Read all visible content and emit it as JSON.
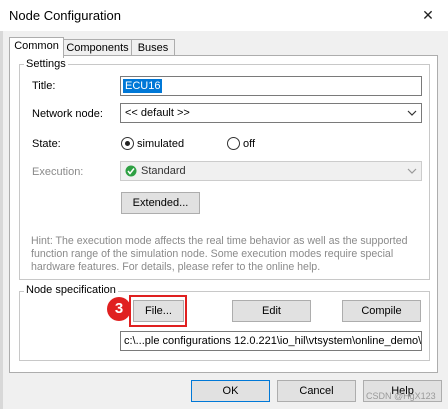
{
  "window": {
    "title": "Node Configuration",
    "close_glyph": "✕"
  },
  "tabs": [
    {
      "label": "Common",
      "active": true
    },
    {
      "label": "Components",
      "active": false
    },
    {
      "label": "Buses",
      "active": false
    }
  ],
  "settings": {
    "legend": "Settings",
    "title_label": "Title:",
    "title_value": "ECU16",
    "network_label": "Network node:",
    "network_value": "<< default >>",
    "state_label": "State:",
    "state_options": [
      "simulated",
      "off"
    ],
    "state_selected": "simulated",
    "execution_label": "Execution:",
    "execution_value": "Standard",
    "extended_button": "Extended...",
    "hint": "Hint: The execution mode affects the real time behavior as well as the supported function range of the simulation node. Some execution modes require special hardware features. For details, please refer to the online help."
  },
  "node_spec": {
    "legend": "Node specification",
    "file_button": "File...",
    "edit_button": "Edit",
    "compile_button": "Compile",
    "path": "c:\\...ple configurations 12.0.221\\io_hil\\vtsystem\\online_demo\\"
  },
  "annotation": {
    "step": "3",
    "color": "#e02020"
  },
  "footer": {
    "ok": "OK",
    "cancel": "Cancel",
    "help": "Help"
  },
  "watermark": "CSDN @HgX123",
  "colors": {
    "selection": "#0078d7",
    "check_green": "#2ea043"
  }
}
